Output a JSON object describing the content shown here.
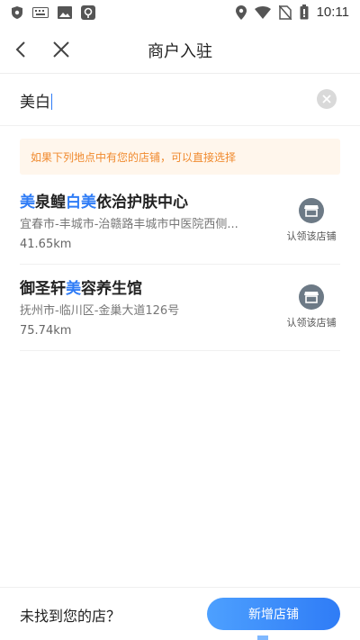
{
  "status_bar": {
    "time": "10:11",
    "left_icons": [
      "shield-icon",
      "keyboard-icon",
      "image-icon",
      "app-icon"
    ],
    "right_icons": [
      "location-icon",
      "wifi-icon",
      "no-sim-icon",
      "battery-icon"
    ]
  },
  "nav": {
    "title": "商户入驻",
    "back_icon": "back-arrow-icon",
    "close_icon": "close-icon"
  },
  "search": {
    "value": "美白",
    "clear_icon": "clear-icon"
  },
  "tip": {
    "text": "如果下列地点中有您的店铺，可以直接选择"
  },
  "results": [
    {
      "title_parts": [
        {
          "text": "美",
          "highlight": true
        },
        {
          "text": "泉鳇",
          "highlight": false
        },
        {
          "text": "白美",
          "highlight": true
        },
        {
          "text": "依治护肤中心",
          "highlight": false
        }
      ],
      "address": "宜春市-丰城市-治赣路丰城市中医院西侧...",
      "distance": "41.65km",
      "claim_label": "认领该店铺"
    },
    {
      "title_parts": [
        {
          "text": "御圣轩",
          "highlight": false
        },
        {
          "text": "美",
          "highlight": true
        },
        {
          "text": "容养生馆",
          "highlight": false
        }
      ],
      "address": "抚州市-临川区-金巢大道126号",
      "distance": "75.74km",
      "claim_label": "认领该店铺"
    }
  ],
  "bottom": {
    "not_found_text": "未找到您的店？",
    "add_button": "新增店铺"
  },
  "colors": {
    "accent": "#2f7cf6",
    "tip_bg": "#fff6ec",
    "tip_text": "#f08a2e"
  }
}
